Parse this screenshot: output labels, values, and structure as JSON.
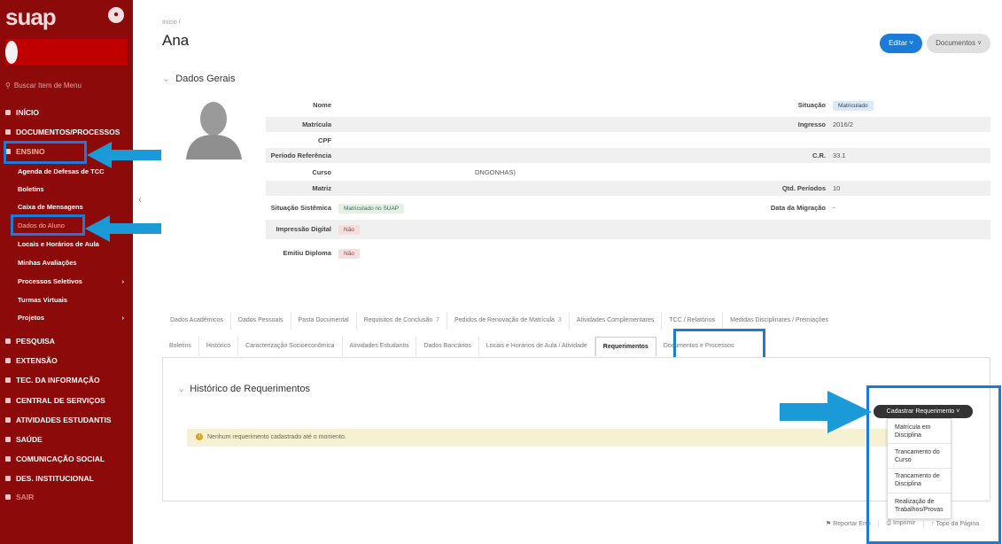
{
  "sidebar": {
    "logo": "suap",
    "search_placeholder": "Buscar Item de Menu",
    "nav_inicio": "INÍCIO",
    "nav_documentos": "DOCUMENTOS/PROCESSOS",
    "nav_ensino": "ENSINO",
    "sub_agenda": "Agenda de Defesas de TCC",
    "sub_boletins": "Boletins",
    "sub_caixa": "Caixa de Mensagens",
    "sub_dados": "Dados do Aluno",
    "sub_locais": "Locais e Horários de Aula",
    "sub_avaliacoes": "Minhas Avaliações",
    "sub_processos": "Processos Seletivos",
    "sub_turmas": "Turmas Virtuais",
    "sub_projetos": "Projetos",
    "nav_pesquisa": "PESQUISA",
    "nav_extensao": "EXTENSÃO",
    "nav_tec": "TEC. DA INFORMAÇÃO",
    "nav_central": "CENTRAL DE SERVIÇOS",
    "nav_atividades": "ATIVIDADES ESTUDANTIS",
    "nav_saude": "SAÚDE",
    "nav_comunicacao": "COMUNICAÇÃO SOCIAL",
    "nav_des": "DES. INSTITUCIONAL",
    "nav_sair": "SAIR"
  },
  "header": {
    "breadcrumb": "Início /",
    "title": "Ana",
    "btn_editar": "Editar ˅",
    "btn_documentos": "Documentos ˅"
  },
  "dados_gerais": {
    "title": "Dados Gerais",
    "nome_label": "Nome",
    "matricula_label": "Matrícula",
    "cpf_label": "CPF",
    "periodo_label": "Período Referência",
    "curso_label": "Curso",
    "curso_value": "DNGONHAS)",
    "matriz_label": "Matriz",
    "situacao_sistemica_label": "Situação Sistêmica",
    "situacao_sistemica_value": "Matriculado no SUAP",
    "impressao_label": "Impressão Digital",
    "impressao_value": "Não",
    "emitiu_label": "Emitiu Diploma",
    "emitiu_value": "Não",
    "situacao_label": "Situação",
    "situacao_value": "Matriculado",
    "ingresso_label": "Ingresso",
    "ingresso_value": "2016/2",
    "cr_label": "C.R.",
    "cr_value": "33.1",
    "qtd_label": "Qtd. Períodos",
    "qtd_value": "10",
    "migracao_label": "Data da Migração",
    "migracao_value": "-"
  },
  "tabs_row1": [
    {
      "label": "Dados Acadêmicos",
      "count": ""
    },
    {
      "label": "Dados Pessoais",
      "count": ""
    },
    {
      "label": "Pasta Documental",
      "count": ""
    },
    {
      "label": "Requisitos de Conclusão",
      "count": "7"
    },
    {
      "label": "Pedidos de Renovação de Matrícula",
      "count": "3"
    },
    {
      "label": "Atividades Complementares",
      "count": ""
    },
    {
      "label": "TCC / Relatórios",
      "count": ""
    },
    {
      "label": "Medidas Disciplinares / Premiações",
      "count": ""
    }
  ],
  "tabs_row2": [
    {
      "label": "Boletins"
    },
    {
      "label": "Histórico"
    },
    {
      "label": "Caracterização Socioeconômica"
    },
    {
      "label": "Atividades Estudantis"
    },
    {
      "label": "Dados Bancários"
    },
    {
      "label": "Locais e Horários de Aula / Atividade"
    },
    {
      "label": "Requerimentos"
    },
    {
      "label": "Documentos e Processos"
    }
  ],
  "requerimentos": {
    "title": "Histórico de Requerimentos",
    "btn_cadastrar": "Cadastrar Requerimento ˅",
    "alert": "Nenhum requerimento cadastrado até o momento.",
    "dropdown": [
      "Matrícula em Disciplina",
      "Trancamento do Curso",
      "Trancamento de Disciplina",
      "Realização de Trabalhos/Provas"
    ]
  },
  "footer": {
    "reportar": "Reportar Erro",
    "imprimir": "Imprimir",
    "topo": "Topo da Página"
  },
  "colors": {
    "sidebar_bg": "#8c0a0a",
    "highlight": "#1a7cd6",
    "primary_button": "#1a7cd6"
  }
}
